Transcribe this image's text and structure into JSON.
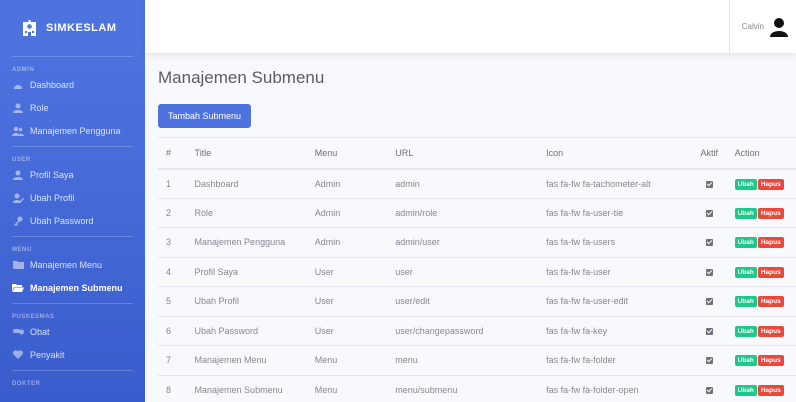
{
  "brand": {
    "name": "SIMKESLAM"
  },
  "sidebar": {
    "sections": [
      {
        "heading": "ADMIN",
        "items": [
          {
            "label": "Dashboard",
            "icon": "tachometer-icon"
          },
          {
            "label": "Role",
            "icon": "user-tie-icon"
          },
          {
            "label": "Manajemen Pengguna",
            "icon": "users-icon"
          }
        ]
      },
      {
        "heading": "USER",
        "items": [
          {
            "label": "Profil Saya",
            "icon": "user-icon"
          },
          {
            "label": "Ubah Profil",
            "icon": "user-edit-icon"
          },
          {
            "label": "Ubah Password",
            "icon": "key-icon"
          }
        ]
      },
      {
        "heading": "MENU",
        "items": [
          {
            "label": "Manajemen Menu",
            "icon": "folder-icon"
          },
          {
            "label": "Manajemen Submenu",
            "icon": "folder-open-icon",
            "active": true
          }
        ]
      },
      {
        "heading": "PUSKESMAS",
        "items": [
          {
            "label": "Obat",
            "icon": "pills-icon"
          },
          {
            "label": "Penyakit",
            "icon": "heart-icon"
          }
        ]
      },
      {
        "heading": "DOKTER",
        "items": []
      }
    ]
  },
  "topbar": {
    "user_name": "Calvin"
  },
  "main": {
    "title": "Manajemen Submenu",
    "add_button": "Tambah Submenu",
    "table": {
      "headers": [
        "#",
        "Title",
        "Menu",
        "URL",
        "Icon",
        "Aktif",
        "Action"
      ],
      "rows": [
        {
          "num": "1",
          "title": "Dashboard",
          "menu": "Admin",
          "url": "admin",
          "icon": "fas fa-fw fa-tachometer-alt"
        },
        {
          "num": "2",
          "title": "Role",
          "menu": "Admin",
          "url": "admin/role",
          "icon": "fas fa-fw fa-user-tie"
        },
        {
          "num": "3",
          "title": "Manajemen Pengguna",
          "menu": "Admin",
          "url": "admin/user",
          "icon": "fas fa-fw fa-users"
        },
        {
          "num": "4",
          "title": "Profil Saya",
          "menu": "User",
          "url": "user",
          "icon": "fas fa-fw fa-user"
        },
        {
          "num": "5",
          "title": "Ubah Profil",
          "menu": "User",
          "url": "user/edit",
          "icon": "fas fa-fw fa-user-edit"
        },
        {
          "num": "6",
          "title": "Ubah Password",
          "menu": "User",
          "url": "user/changepassword",
          "icon": "fas fa-fw fa-key"
        },
        {
          "num": "7",
          "title": "Manajemen Menu",
          "menu": "Menu",
          "url": "menu",
          "icon": "fas fa-fw fa-folder"
        },
        {
          "num": "8",
          "title": "Manajemen Submenu",
          "menu": "Menu",
          "url": "menu/submenu",
          "icon": "fas fa-fw fa-folder-open"
        }
      ],
      "edit_label": "Ubah",
      "delete_label": "Hapus",
      "aktif_checked": true
    }
  },
  "colors": {
    "primary": "#4e73df",
    "success": "#1cc88a",
    "danger": "#e74a3b"
  }
}
